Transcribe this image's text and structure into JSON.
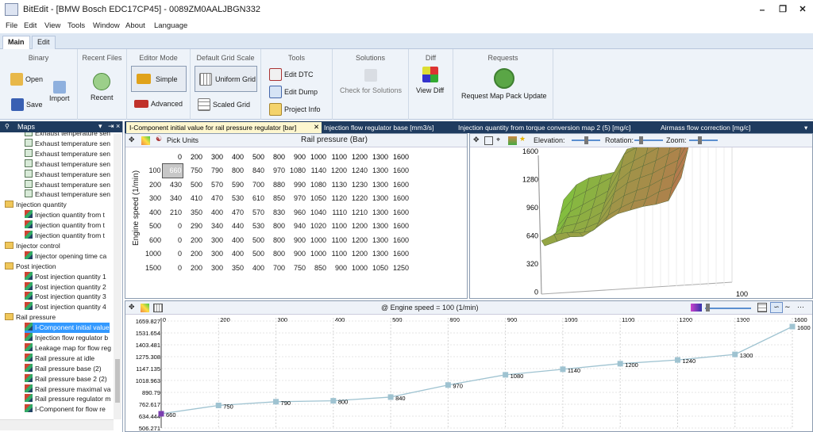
{
  "window": {
    "title": "BitEdit - [BMW Bosch EDC17CP45] - 0089ZM0AALJBGN332",
    "min": "–",
    "restore": "❐",
    "close": "✕"
  },
  "menu": [
    "File",
    "Edit",
    "View",
    "Tools",
    "Window",
    "About",
    "Language"
  ],
  "ribbon_tabs": [
    "Main",
    "Edit"
  ],
  "ribbon": {
    "binary": {
      "title": "Binary",
      "open": "Open",
      "import": "Import",
      "save": "Save"
    },
    "recent": {
      "title": "Recent Files",
      "recent": "Recent"
    },
    "editor_mode": {
      "title": "Editor Mode",
      "simple": "Simple",
      "advanced": "Advanced"
    },
    "grid_scale": {
      "title": "Default Grid Scale",
      "uniform": "Uniform Grid",
      "scaled": "Scaled Grid"
    },
    "tools": {
      "title": "Tools",
      "edit_dtc": "Edit DTC",
      "edit_dump": "Edit Dump",
      "project_info": "Project Info"
    },
    "solutions": {
      "title": "Solutions",
      "check": "Check for Solutions"
    },
    "diff": {
      "title": "Diff",
      "view": "View Diff"
    },
    "requests": {
      "title": "Requests",
      "update": "Request Map Pack Update"
    }
  },
  "maps_panel": {
    "title": "Maps",
    "items": [
      {
        "label": "Exhaust temperature sen",
        "kind": "map",
        "indent": 2
      },
      {
        "label": "Exhaust temperature sen",
        "kind": "map",
        "indent": 2
      },
      {
        "label": "Exhaust temperature sen",
        "kind": "map",
        "indent": 2
      },
      {
        "label": "Exhaust temperature sen",
        "kind": "map",
        "indent": 2
      },
      {
        "label": "Exhaust temperature sen",
        "kind": "map",
        "indent": 2
      },
      {
        "label": "Exhaust temperature sen",
        "kind": "map",
        "indent": 2
      },
      {
        "label": "Exhaust temperature sen",
        "kind": "map",
        "indent": 2
      },
      {
        "label": "Injection quantity",
        "kind": "folder",
        "indent": 1
      },
      {
        "label": "Injection quantity from t",
        "kind": "curve",
        "indent": 2
      },
      {
        "label": "Injection quantity from t",
        "kind": "curve",
        "indent": 2
      },
      {
        "label": "Injection quantity from t",
        "kind": "curve",
        "indent": 2
      },
      {
        "label": "Injector control",
        "kind": "folder",
        "indent": 1
      },
      {
        "label": "Injector opening time ca",
        "kind": "curve",
        "indent": 2
      },
      {
        "label": "Post injection",
        "kind": "folder",
        "indent": 1
      },
      {
        "label": "Post injection quantity 1",
        "kind": "curve",
        "indent": 2
      },
      {
        "label": "Post injection quantity 2",
        "kind": "curve",
        "indent": 2
      },
      {
        "label": "Post injection quantity 3",
        "kind": "curve",
        "indent": 2
      },
      {
        "label": "Post injection quantity 4",
        "kind": "curve",
        "indent": 2
      },
      {
        "label": "Rail pressure",
        "kind": "folder",
        "indent": 1
      },
      {
        "label": "I-Component initial value",
        "kind": "curve",
        "indent": 2,
        "selected": true
      },
      {
        "label": "Injection flow regulator b",
        "kind": "curve",
        "indent": 2
      },
      {
        "label": "Leakage map for flow reg",
        "kind": "curve",
        "indent": 2
      },
      {
        "label": "Rail pressure at idle",
        "kind": "curve",
        "indent": 2
      },
      {
        "label": "Rail pressure base (2)",
        "kind": "curve",
        "indent": 2
      },
      {
        "label": "Rail pressure base 2 (2)",
        "kind": "curve",
        "indent": 2
      },
      {
        "label": "Rail pressure maximal va",
        "kind": "curve",
        "indent": 2
      },
      {
        "label": "Rail pressure regulator m",
        "kind": "curve",
        "indent": 2
      },
      {
        "label": "I-Component for flow re",
        "kind": "curve",
        "indent": 2
      }
    ]
  },
  "doc_tabs": [
    "I-Component initial value for rail pressure regulator [bar]",
    "Injection flow regulator base [mm3/s]",
    "Injection quantity from torque conversion map 2 (5) [mg/c]",
    "Airmass flow correction [mg/c]"
  ],
  "table": {
    "pick_units": "Pick Units",
    "x_axis_label": "Rail pressure (Bar)",
    "y_axis_label": "Engine speed (1/min)",
    "columns": [
      0,
      200,
      300,
      400,
      500,
      800,
      900,
      1000,
      1100,
      1200,
      1300,
      1600
    ],
    "rows": [
      {
        "rpm": 100,
        "values": [
          660,
          750,
          790,
          800,
          840,
          970,
          1080,
          1140,
          1200,
          1240,
          1300,
          1600
        ]
      },
      {
        "rpm": 200,
        "values": [
          430,
          500,
          570,
          590,
          700,
          880,
          990,
          1080,
          1130,
          1230,
          1300,
          1600
        ]
      },
      {
        "rpm": 300,
        "values": [
          340,
          410,
          470,
          530,
          610,
          850,
          970,
          1050,
          1120,
          1220,
          1300,
          1600
        ]
      },
      {
        "rpm": 400,
        "values": [
          210,
          350,
          400,
          470,
          570,
          830,
          960,
          1040,
          1110,
          1210,
          1300,
          1600
        ]
      },
      {
        "rpm": 500,
        "values": [
          0,
          290,
          340,
          440,
          530,
          800,
          940,
          1020,
          1100,
          1200,
          1300,
          1600
        ]
      },
      {
        "rpm": 600,
        "values": [
          0,
          200,
          300,
          400,
          500,
          800,
          900,
          1000,
          1100,
          1200,
          1300,
          1600
        ]
      },
      {
        "rpm": 1000,
        "values": [
          0,
          200,
          300,
          400,
          500,
          800,
          900,
          1000,
          1100,
          1200,
          1300,
          1600
        ]
      },
      {
        "rpm": 1500,
        "values": [
          0,
          200,
          300,
          350,
          400,
          700,
          750,
          850,
          900,
          1000,
          1050,
          1250
        ]
      }
    ]
  },
  "plot3d": {
    "elevation": "Elevation:",
    "rotation": "Rotation:",
    "zoom": "Zoom:",
    "z_ticks": [
      "1600",
      "1280",
      "960",
      "640",
      "320",
      "0"
    ],
    "corner_tick": "100"
  },
  "line_chart": {
    "title": "@ Engine speed = 100 (1/min)"
  },
  "chart_data": {
    "type": "line",
    "title": "@ Engine speed = 100 (1/min)",
    "x": [
      "0",
      "200",
      "300",
      "400",
      "500",
      "800",
      "900",
      "1000",
      "1100",
      "1200",
      "1300",
      "1600"
    ],
    "values": [
      660,
      750,
      790,
      800,
      840,
      970,
      1080,
      1140,
      1200,
      1240,
      1300,
      1600
    ],
    "y_ticks": [
      "1659.827",
      "1531.654",
      "1403.481",
      "1275.308",
      "1147.135",
      "1018.963",
      "890.79",
      "762.617",
      "634.444",
      "506.271"
    ],
    "ylim": [
      506.271,
      1659.827
    ],
    "grid": true,
    "line_color": "#9fc3d1",
    "marker_color": "#9fc3d1",
    "first_marker_color": "#7b3fb0"
  },
  "colors": {
    "ribbon_bg": "#eef3f9",
    "dark_header": "#1f3b5f",
    "selected": "#3399ff",
    "surface_high": "#b8734f",
    "surface_low": "#7fc23e"
  }
}
